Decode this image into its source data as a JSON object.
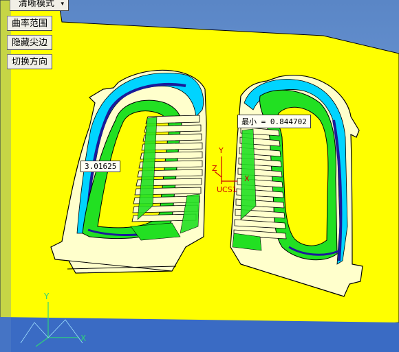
{
  "toolbar": {
    "mode_select": {
      "value": "清晰模式",
      "arrow": "▾"
    },
    "buttons": [
      "曲率范围",
      "隐藏尖边",
      "切换方向"
    ]
  },
  "annotations": {
    "left_value": "3.01625",
    "right_value": "最小 = 0.844702"
  },
  "csys": {
    "x": "X",
    "y": "Y",
    "z": "Z",
    "name": "UCS1"
  },
  "triad": {
    "x": "X",
    "y": "Y"
  },
  "colors": {
    "background": "#6d97d4",
    "plane": "#ffff00",
    "curvature_high": "#00dd00",
    "curvature_mid": "#00e0ff",
    "curvature_low": "#1010a0",
    "csys": "#cc0000"
  }
}
